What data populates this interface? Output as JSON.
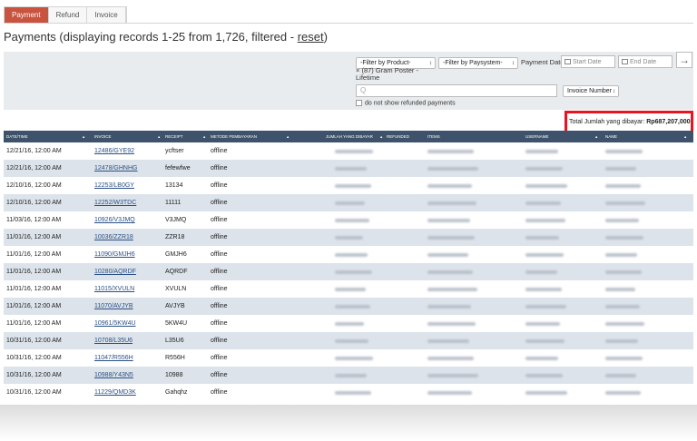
{
  "tabs": [
    {
      "label": "Payment",
      "active": true
    },
    {
      "label": "Refund",
      "active": false
    },
    {
      "label": "Invoice",
      "active": false
    }
  ],
  "page": {
    "title_prefix": "Payments (displaying records 1-25 from 1,726, filtered - ",
    "reset_label": "reset",
    "title_suffix": ")"
  },
  "filters": {
    "product_select": "-Filter by Product-",
    "selected_product": "× (87) Gram Poster - Lifetime",
    "paysystem_select": "-Filter by Paysystem-",
    "payment_date_label": "Payment Date:",
    "start_date_placeholder": "Start Date",
    "end_date_placeholder": "End Date",
    "search_placeholder": "Q",
    "search_type": "Invoice Number",
    "no_refunded_label": "do not show refunded payments"
  },
  "summary": {
    "total_label": "Total Jumlah yang dibayar:",
    "total_value": "Rp687,207,000"
  },
  "table": {
    "columns": [
      "DATE/TIME",
      "INVOICE",
      "RECEIPT",
      "METODE PEMBAYARAN",
      "JUMLAH YANG DIBAYAR",
      "REFUNDED",
      "ITEMS",
      "USERNAME",
      "NAME"
    ],
    "rows": [
      {
        "date": "12/21/16, 12:00 AM",
        "invoice": "12486/GYE92",
        "receipt": "ycftser",
        "method": "offline"
      },
      {
        "date": "12/21/16, 12:00 AM",
        "invoice": "12478/GHNHG",
        "receipt": "fefewfwe",
        "method": "offline"
      },
      {
        "date": "12/10/16, 12:00 AM",
        "invoice": "12253/LB0GY",
        "receipt": "13134",
        "method": "offline"
      },
      {
        "date": "12/10/16, 12:00 AM",
        "invoice": "12252/W3TDC",
        "receipt": "11111",
        "method": "offline"
      },
      {
        "date": "11/03/16, 12:00 AM",
        "invoice": "10926/V3JMQ",
        "receipt": "V3JMQ",
        "method": "offline"
      },
      {
        "date": "11/01/16, 12:00 AM",
        "invoice": "10036/ZZR18",
        "receipt": "ZZR18",
        "method": "offline"
      },
      {
        "date": "11/01/16, 12:00 AM",
        "invoice": "11090/GMJH6",
        "receipt": "GMJH6",
        "method": "offline"
      },
      {
        "date": "11/01/16, 12:00 AM",
        "invoice": "10280/AQRDF",
        "receipt": "AQRDF",
        "method": "offline"
      },
      {
        "date": "11/01/16, 12:00 AM",
        "invoice": "11015/XVULN",
        "receipt": "XVULN",
        "method": "offline"
      },
      {
        "date": "11/01/16, 12:00 AM",
        "invoice": "11070/AVJYB",
        "receipt": "AVJYB",
        "method": "offline"
      },
      {
        "date": "11/01/16, 12:00 AM",
        "invoice": "10961/5KW4U",
        "receipt": "5KW4U",
        "method": "offline"
      },
      {
        "date": "10/31/16, 12:00 AM",
        "invoice": "10708/L35U6",
        "receipt": "L35U6",
        "method": "offline"
      },
      {
        "date": "10/31/16, 12:00 AM",
        "invoice": "11047/R556H",
        "receipt": "R556H",
        "method": "offline"
      },
      {
        "date": "10/31/16, 12:00 AM",
        "invoice": "10988/Y43N5",
        "receipt": "10988",
        "method": "offline"
      },
      {
        "date": "10/31/16, 12:00 AM",
        "invoice": "11229/QMD3K",
        "receipt": "Gahqhz",
        "method": "offline"
      }
    ]
  },
  "colors": {
    "active_tab": "#c8533f",
    "table_header": "#3e536b",
    "highlight_border": "#e8141f",
    "link": "#2b4f84"
  }
}
